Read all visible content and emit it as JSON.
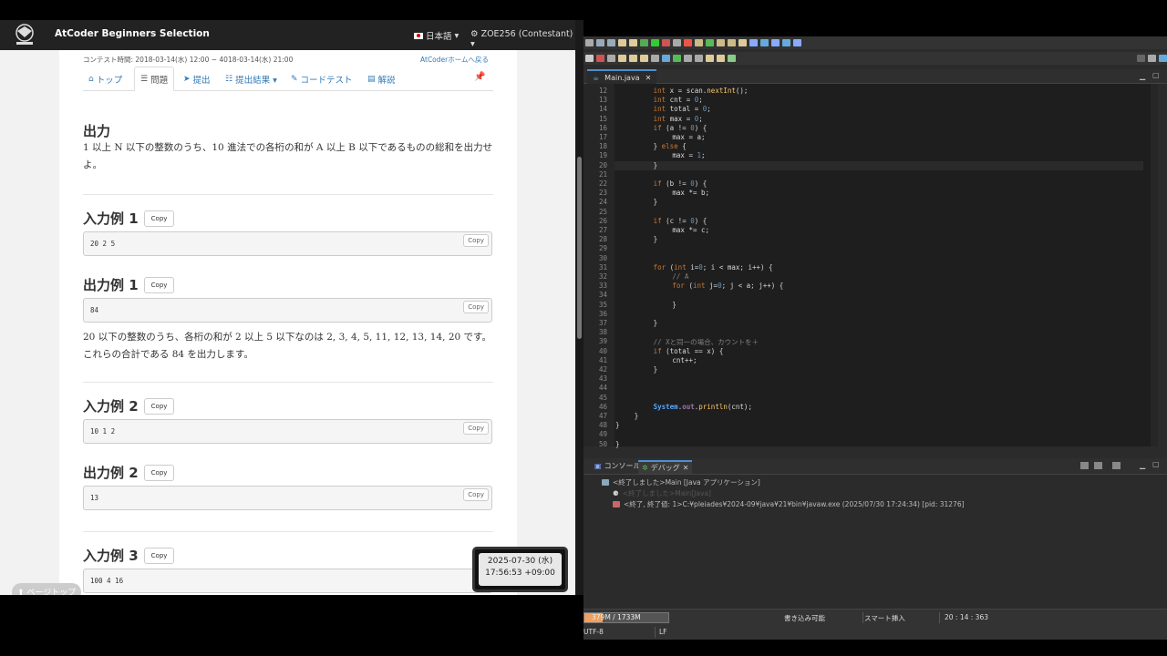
{
  "browser": {
    "brand": "AtCoder Beginners Selection",
    "language": "日本語",
    "user": "ZOE256 (Contestant)",
    "contest_time": "コンテスト時間: 2018-03-14(水) 12:00 ~ 4018-03-14(水) 21:00",
    "home_link": "AtCoderホームへ戻る",
    "tabs": [
      {
        "icon": "⌂",
        "label": "トップ"
      },
      {
        "icon": "☰",
        "label": "問題"
      },
      {
        "icon": "➤",
        "label": "提出"
      },
      {
        "icon": "☷",
        "label": "提出結果 ▾"
      },
      {
        "icon": "✎",
        "label": "コードテスト"
      },
      {
        "icon": "▤",
        "label": "解説"
      }
    ],
    "output_heading": "出力",
    "output_text": "1 以上 N 以下の整数のうち、10 進法での各桁の和が A 以上 B 以下であるものの総和を出力せよ。",
    "copy_label": "Copy",
    "sample_in_1": "入力例 1",
    "sample_in_1_value": "20 2 5",
    "sample_out_1": "出力例 1",
    "sample_out_1_value": "84",
    "explanation_1": "20 以下の整数のうち、各桁の和が 2 以上 5 以下なのは 2, 3, 4, 5, 11, 12, 13, 14, 20 です。これらの合計である 84 を出力します。",
    "sample_in_2": "入力例 2",
    "sample_in_2_value": "10 1 2",
    "sample_out_2": "出力例 2",
    "sample_out_2_value": "13",
    "sample_in_3": "入力例 3",
    "sample_in_3_value": "100 4 16",
    "page_top": "⬆ ページトップ"
  },
  "clock": {
    "date": "2025-07-30 (水)",
    "time": "17:56:53 +09:00"
  },
  "editor": {
    "tab": "Main.java",
    "tab_close": "✕",
    "lines": [
      {
        "n": "12",
        "i": 8,
        "html": "<span class='kw'>int</span> x = scan.<span class='fn'>nextInt</span>();"
      },
      {
        "n": "13",
        "i": 8,
        "html": "<span class='kw'>int</span> cnt = <span class='num'>0</span>;"
      },
      {
        "n": "14",
        "i": 8,
        "html": "<span class='kw'>int</span> total = <span class='num'>0</span>;"
      },
      {
        "n": "15",
        "i": 8,
        "html": "<span class='kw'>int</span> max = <span class='num'>0</span>;"
      },
      {
        "n": "16",
        "i": 8,
        "html": "<span class='kw'>if</span> (a != <span class='num'>0</span>) {"
      },
      {
        "n": "17",
        "i": 12,
        "html": "max = a;"
      },
      {
        "n": "18",
        "i": 8,
        "html": "} <span class='kw'>else</span> {"
      },
      {
        "n": "19",
        "i": 12,
        "html": "max = <span class='num'>1</span>;"
      },
      {
        "n": "20",
        "i": 8,
        "html": "}"
      },
      {
        "n": "21",
        "i": 0,
        "html": ""
      },
      {
        "n": "22",
        "i": 8,
        "html": "<span class='kw'>if</span> (b != <span class='num'>0</span>) {"
      },
      {
        "n": "23",
        "i": 12,
        "html": "max *= b;"
      },
      {
        "n": "24",
        "i": 8,
        "html": "}"
      },
      {
        "n": "25",
        "i": 0,
        "html": ""
      },
      {
        "n": "26",
        "i": 8,
        "html": "<span class='kw'>if</span> (c != <span class='num'>0</span>) {"
      },
      {
        "n": "27",
        "i": 12,
        "html": "max *= c;"
      },
      {
        "n": "28",
        "i": 8,
        "html": "}"
      },
      {
        "n": "29",
        "i": 0,
        "html": ""
      },
      {
        "n": "30",
        "i": 0,
        "html": ""
      },
      {
        "n": "31",
        "i": 8,
        "html": "<span class='kw'>for</span> (<span class='kw'>int</span> i=<span class='num'>0</span>; i &lt; max; i++) {"
      },
      {
        "n": "32",
        "i": 12,
        "html": "<span class='cm'>// A</span>"
      },
      {
        "n": "33",
        "i": 12,
        "html": "<span class='kw'>for</span> (<span class='kw'>int</span> j=<span class='num'>0</span>; j &lt; a; j++) {"
      },
      {
        "n": "34",
        "i": 0,
        "html": ""
      },
      {
        "n": "35",
        "i": 12,
        "html": "}"
      },
      {
        "n": "36",
        "i": 0,
        "html": ""
      },
      {
        "n": "37",
        "i": 8,
        "html": "}"
      },
      {
        "n": "38",
        "i": 0,
        "html": ""
      },
      {
        "n": "39",
        "i": 8,
        "html": "<span class='cm'>// Xと同一の場合、カウントを＋</span>"
      },
      {
        "n": "40",
        "i": 8,
        "html": "<span class='kw'>if</span> (total == x) {"
      },
      {
        "n": "41",
        "i": 12,
        "html": "cnt++;"
      },
      {
        "n": "42",
        "i": 8,
        "html": "}"
      },
      {
        "n": "43",
        "i": 0,
        "html": ""
      },
      {
        "n": "44",
        "i": 0,
        "html": ""
      },
      {
        "n": "45",
        "i": 0,
        "html": ""
      },
      {
        "n": "46",
        "i": 8,
        "html": "<span class='st'>System</span>.<span class='fld'>out</span>.<span class='fn'>println</span>(cnt);"
      },
      {
        "n": "47",
        "i": 4,
        "html": "}"
      },
      {
        "n": "48",
        "i": 0,
        "html": "}"
      },
      {
        "n": "49",
        "i": 0,
        "html": ""
      },
      {
        "n": "50",
        "i": 0,
        "html": "}"
      }
    ]
  },
  "console": {
    "tab_console": "コンソール",
    "tab_debug": "デバッグ",
    "tab_close": "✕",
    "row1": "<終了しました>Main [Java アプリケーション]",
    "row2": "<終了しました>Main[Java]",
    "row3": "<終了, 終了値: 1>C:¥pleiades¥2024-09¥java¥21¥bin¥javaw.exe (2025/07/30 17:24:34) [pid: 31276]"
  },
  "status": {
    "heap": "379M / 1733M",
    "heap_fraction": 0.22,
    "writable": "書き込み可能",
    "insert": "スマート挿入",
    "position": "20 : 14 : 363",
    "encoding": "UTF-8",
    "eol": "LF"
  }
}
